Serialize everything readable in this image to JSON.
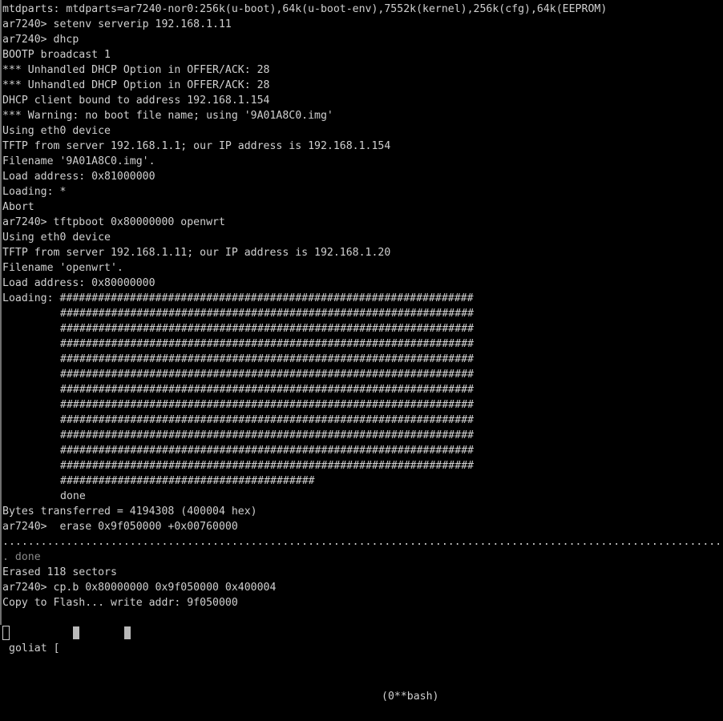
{
  "terminal": {
    "lines": [
      "mtdparts: mtdparts=ar7240-nor0:256k(u-boot),64k(u-boot-env),7552k(kernel),256k(cfg),64k(EEPROM)",
      "ar7240> setenv serverip 192.168.1.11",
      "ar7240> dhcp",
      "BOOTP broadcast 1",
      "*** Unhandled DHCP Option in OFFER/ACK: 28",
      "*** Unhandled DHCP Option in OFFER/ACK: 28",
      "DHCP client bound to address 192.168.1.154",
      "*** Warning: no boot file name; using '9A01A8C0.img'",
      "Using eth0 device",
      "TFTP from server 192.168.1.1; our IP address is 192.168.1.154",
      "Filename '9A01A8C0.img'.",
      "Load address: 0x81000000",
      "Loading: *",
      "Abort",
      "ar7240> tftpboot 0x80000000 openwrt",
      "Using eth0 device",
      "TFTP from server 192.168.1.11; our IP address is 192.168.1.20",
      "Filename 'openwrt'.",
      "Load address: 0x80000000",
      "Loading: #################################################################",
      "#################################################################",
      "#################################################################",
      "#################################################################",
      "#################################################################",
      "#################################################################",
      "#################################################################",
      "#################################################################",
      "#################################################################",
      "#################################################################",
      "#################################################################",
      "#################################################################",
      "########################################",
      "done",
      "Bytes transferred = 4194308 (400004 hex)",
      "ar7240>  erase 0x9f050000 +0x00760000",
      "................................................................................................................................",
      ". done",
      "Erased 118 sectors",
      "ar7240> cp.b 0x80000000 0x9f050000 0x400004",
      "Copy to Flash... write addr: 9f050000"
    ]
  },
  "status_bar": {
    "session": "goliat [",
    "window": "(0**bash)"
  }
}
